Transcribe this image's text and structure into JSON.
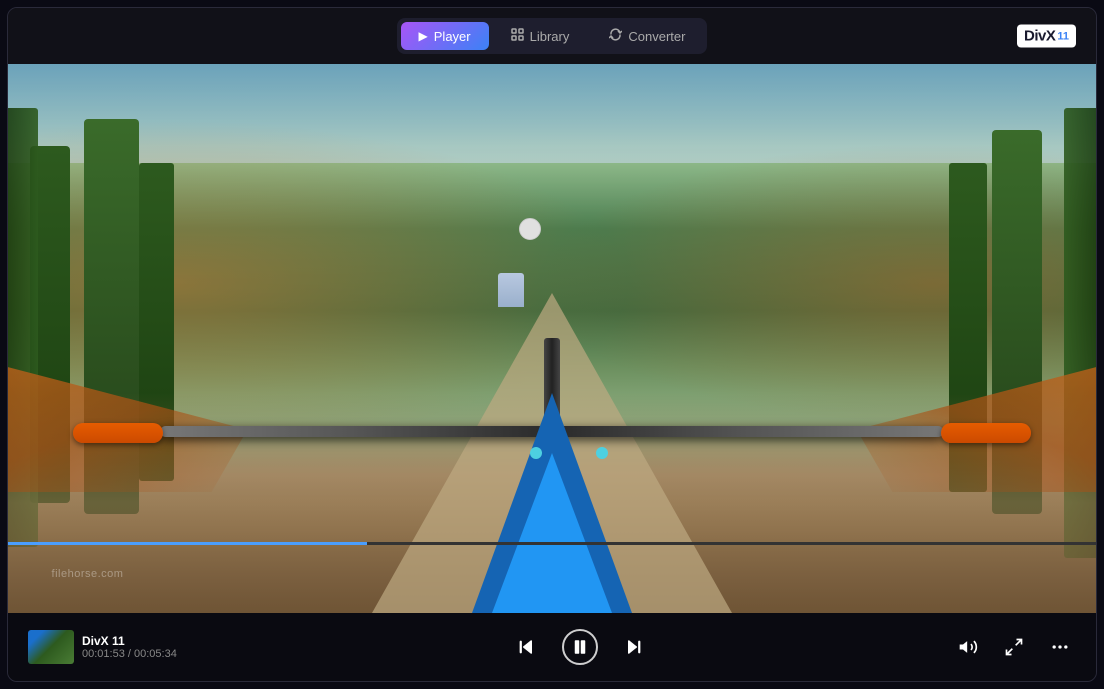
{
  "app": {
    "title": "DivX 11 Player",
    "logo_divx": "DivX",
    "logo_number": "11"
  },
  "nav": {
    "tabs": [
      {
        "id": "player",
        "label": "Player",
        "icon": "▶",
        "active": true
      },
      {
        "id": "library",
        "label": "Library",
        "icon": "⊞",
        "active": false
      },
      {
        "id": "converter",
        "label": "Converter",
        "icon": "↺",
        "active": false
      }
    ]
  },
  "player": {
    "track_title": "DivX 11",
    "watermark": "filehorse.com",
    "current_time": "00:01:53",
    "total_time": "00:05:34",
    "time_display": "00:01:53 / 00:05:34",
    "progress_percent": 33
  },
  "controls": {
    "skip_back_label": "⏮",
    "pause_label": "⏸",
    "skip_forward_label": "⏭",
    "volume_label": "🔊",
    "fullscreen_label": "⛶",
    "more_label": "···"
  }
}
